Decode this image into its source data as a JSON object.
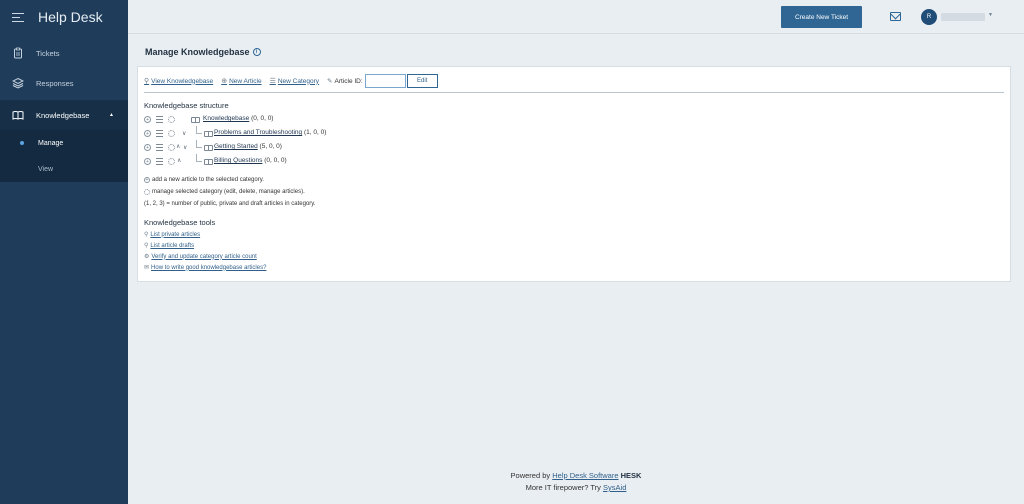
{
  "app": {
    "title": "Help Desk"
  },
  "sidebar": {
    "items": [
      {
        "label": "Tickets",
        "icon": "clipboard-icon"
      },
      {
        "label": "Responses",
        "icon": "layers-icon"
      },
      {
        "label": "Knowledgebase",
        "icon": "open-book-icon",
        "expanded": true
      }
    ],
    "sub_items": [
      {
        "label": "Manage",
        "active": true
      },
      {
        "label": "View",
        "active": false
      }
    ]
  },
  "header": {
    "create_ticket_label": "Create New Ticket",
    "user_initial": "R"
  },
  "main": {
    "title": "Manage Knowledgebase",
    "info_glyph": "i",
    "toolbar": {
      "view_kb": "View Knowledgebase",
      "new_article": "New Article",
      "new_category": "New Category",
      "article_id_label": "Article ID:",
      "article_id_value": "",
      "edit_label": "Edit"
    },
    "structure_title": "Knowledgebase structure",
    "categories": [
      {
        "name": "Knowledgebase",
        "counts": "(0, 0, 0)",
        "level": 0
      },
      {
        "name": "Problems and Troubleshooting",
        "counts": "(1, 0, 0)",
        "level": 1
      },
      {
        "name": "Getting Started",
        "counts": "(5, 0, 0)",
        "level": 1
      },
      {
        "name": "Billing Questions",
        "counts": "(0, 0, 0)",
        "level": 1
      }
    ],
    "legend": {
      "add": "add a new article to the selected category.",
      "manage": "manage selected category (edit, delete, manage articles).",
      "counts": "(1, 2, 3) = number of public, private and draft articles in category."
    },
    "tools_title": "Knowledgebase tools",
    "tools": [
      {
        "label": "List private articles",
        "icon": "search-icon"
      },
      {
        "label": "List article drafts",
        "icon": "search-icon"
      },
      {
        "label": "Verify and update category article count",
        "icon": "gear-icon"
      },
      {
        "label": "How to write good knowledgebase articles?",
        "icon": "help-icon"
      }
    ]
  },
  "footer": {
    "powered_prefix": "Powered by",
    "powered_link": "Help Desk Software",
    "brand": "HESK",
    "more_prefix": "More IT firepower? Try",
    "more_link": "SysAid"
  },
  "colors": {
    "sidebar": "#1f3d5a",
    "accent": "#2f6694",
    "background": "#e9eef2"
  }
}
